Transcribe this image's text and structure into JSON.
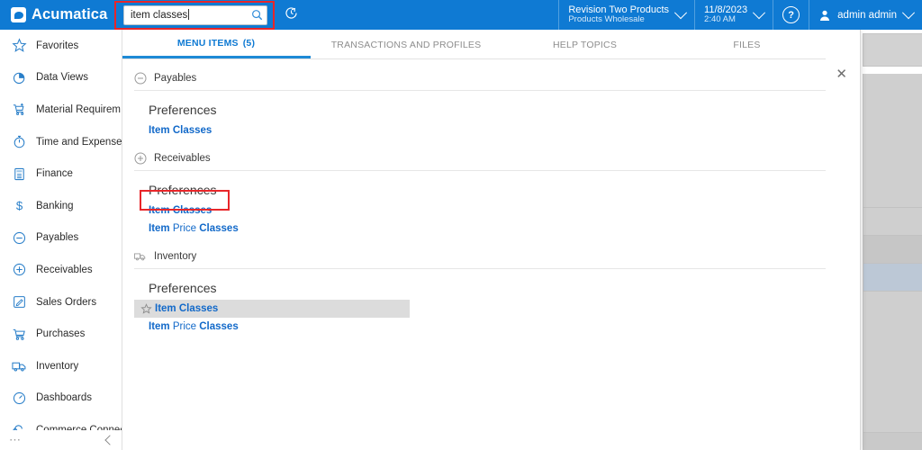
{
  "topbar": {
    "brand": "Acumatica",
    "brand_logo_icon": "acumatica-logo-icon",
    "search": {
      "value": "item classes",
      "placeholder": "Search",
      "icon": "search-icon"
    },
    "history_button": {
      "icon": "recently-viewed-clock-icon",
      "label": "Recently Viewed"
    },
    "company": {
      "name": "Revision Two Products",
      "branch": "Products Wholesale",
      "icon": "chevron-down-icon"
    },
    "datetime": {
      "date": "11/8/2023",
      "time": "2:40 AM",
      "icon": "chevron-down-icon"
    },
    "help": {
      "icon": "help-circle-icon",
      "glyph": "?"
    },
    "user": {
      "name": "admin admin",
      "icon": "user-avatar-icon",
      "chevron": "chevron-down-icon"
    }
  },
  "sidebar": {
    "items": [
      {
        "label": "Favorites",
        "icon": "star-icon"
      },
      {
        "label": "Data Views",
        "icon": "pie-chart-icon"
      },
      {
        "label": "Material Requirem...",
        "icon": "cart-plus-icon"
      },
      {
        "label": "Time and Expenses",
        "icon": "stopwatch-icon"
      },
      {
        "label": "Finance",
        "icon": "calculator-icon"
      },
      {
        "label": "Banking",
        "icon": "dollar-icon"
      },
      {
        "label": "Payables",
        "icon": "circle-minus-icon"
      },
      {
        "label": "Receivables",
        "icon": "circle-plus-icon"
      },
      {
        "label": "Sales Orders",
        "icon": "pencil-square-icon"
      },
      {
        "label": "Purchases",
        "icon": "shopping-cart-icon"
      },
      {
        "label": "Inventory",
        "icon": "truck-icon"
      },
      {
        "label": "Dashboards",
        "icon": "gauge-icon"
      },
      {
        "label": "Commerce Connec",
        "icon": "arrow-loop-icon"
      }
    ],
    "footer": {
      "more_icon": "more-dots-icon",
      "collapse_icon": "chevron-left-icon"
    }
  },
  "dropdown": {
    "tabs": [
      {
        "label": "MENU ITEMS",
        "count": "(5)",
        "active": true
      },
      {
        "label": "TRANSACTIONS AND PROFILES",
        "count": "",
        "active": false
      },
      {
        "label": "HELP TOPICS",
        "count": "",
        "active": false
      },
      {
        "label": "FILES",
        "count": "",
        "active": false
      }
    ],
    "close_icon": "close-icon",
    "groups": [
      {
        "title": "Payables",
        "icon": "circle-minus-icon",
        "subhead": "Preferences",
        "links": [
          {
            "pre": "Item Classes",
            "dim": "",
            "post": "",
            "hovered": false,
            "starred": false
          }
        ]
      },
      {
        "title": "Receivables",
        "icon": "circle-plus-icon",
        "subhead": "Preferences",
        "links": [
          {
            "pre": "Item Classes",
            "dim": "",
            "post": "",
            "hovered": false,
            "starred": false
          },
          {
            "pre": "Item ",
            "dim": "Price ",
            "post": "Classes",
            "hovered": false,
            "starred": false
          }
        ]
      },
      {
        "title": "Inventory",
        "icon": "truck-icon",
        "subhead": "Preferences",
        "links": [
          {
            "pre": "Item Classes",
            "dim": "",
            "post": "",
            "hovered": true,
            "starred": true
          },
          {
            "pre": "Item ",
            "dim": "Price ",
            "post": "Classes",
            "hovered": false,
            "starred": false
          }
        ]
      }
    ]
  },
  "background_page": {
    "close_icon": "close-icon",
    "collapse_icon": "caret-up-icon",
    "pager": {
      "next_icon": "next-page-icon",
      "last_icon": "last-page-icon",
      "next_glyph": "›",
      "last_glyph": "›|"
    }
  },
  "annotations": {
    "color": "#e8262a",
    "boxes": [
      {
        "name": "search-input-highlight"
      },
      {
        "name": "receivables-item-classes-highlight"
      }
    ]
  }
}
